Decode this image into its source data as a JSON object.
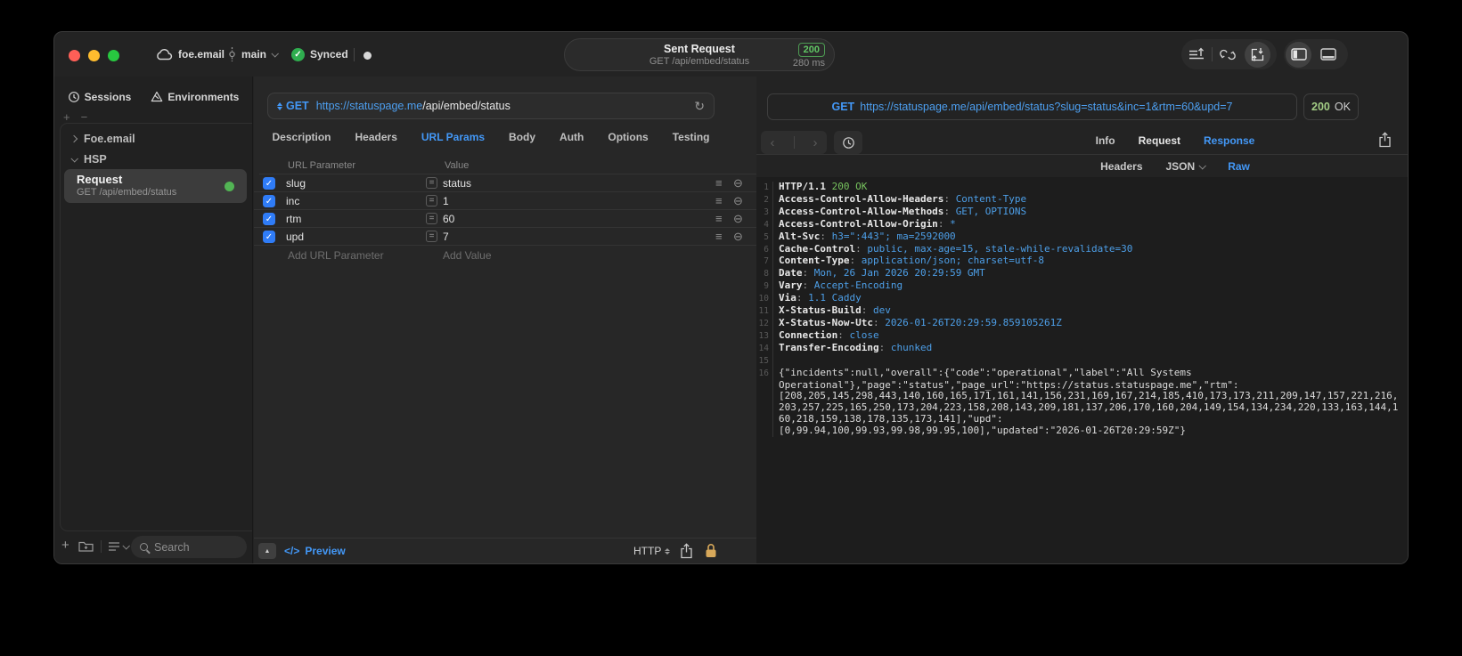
{
  "titlebar": {
    "project": "foe.email",
    "branch": "main",
    "sync": "Synced",
    "request_title": "Sent Request",
    "request_subtitle": "GET /api/embed/status",
    "status_code": "200",
    "duration": "280 ms"
  },
  "sidebar": {
    "tabs": [
      {
        "label": "Sessions"
      },
      {
        "label": "Environments"
      }
    ],
    "tree": [
      {
        "label": "Foe.email"
      },
      {
        "label": "HSP"
      }
    ],
    "request_item": {
      "title": "Request",
      "subtitle": "GET /api/embed/status"
    },
    "search_placeholder": "Search"
  },
  "request": {
    "method": "GET",
    "url_host": "https://statuspage.me",
    "url_path": "/api/embed/status",
    "tabs": [
      {
        "label": "Description"
      },
      {
        "label": "Headers"
      },
      {
        "label": "URL Params"
      },
      {
        "label": "Body"
      },
      {
        "label": "Auth"
      },
      {
        "label": "Options"
      },
      {
        "label": "Testing"
      }
    ],
    "active_tab": "URL Params",
    "table": {
      "col_param": "URL Parameter",
      "col_value": "Value",
      "rows": [
        {
          "name": "slug",
          "value": "status"
        },
        {
          "name": "inc",
          "value": "1"
        },
        {
          "name": "rtm",
          "value": "60"
        },
        {
          "name": "upd",
          "value": "7"
        }
      ],
      "add_param": "Add URL Parameter",
      "add_value": "Add Value"
    },
    "footer": {
      "preview": "Preview",
      "protocol": "HTTP"
    }
  },
  "response": {
    "method": "GET",
    "url": "https://statuspage.me/api/embed/status?slug=status&inc=1&rtm=60&upd=7",
    "status_code": "200",
    "status_text": "OK",
    "tabs": [
      {
        "label": "Info"
      },
      {
        "label": "Request"
      },
      {
        "label": "Response"
      }
    ],
    "active_tab": "Response",
    "subtabs": [
      {
        "label": "Headers"
      },
      {
        "label": "JSON"
      },
      {
        "label": "Raw"
      }
    ],
    "active_subtab": "Raw",
    "lines": [
      {
        "n": "1",
        "seg": [
          [
            "HTTP/1.1 ",
            "h"
          ],
          [
            "200 OK",
            "g"
          ]
        ]
      },
      {
        "n": "2",
        "seg": [
          [
            "Access-Control-Allow-Headers",
            "h"
          ],
          [
            ": ",
            "p"
          ],
          [
            "Content-Type",
            "v"
          ]
        ]
      },
      {
        "n": "3",
        "seg": [
          [
            "Access-Control-Allow-Methods",
            "h"
          ],
          [
            ": ",
            "p"
          ],
          [
            "GET, OPTIONS",
            "v"
          ]
        ]
      },
      {
        "n": "4",
        "seg": [
          [
            "Access-Control-Allow-Origin",
            "h"
          ],
          [
            ": ",
            "p"
          ],
          [
            "*",
            "v"
          ]
        ]
      },
      {
        "n": "5",
        "seg": [
          [
            "Alt-Svc",
            "h"
          ],
          [
            ": ",
            "p"
          ],
          [
            "h3=\":443\"; ma=2592000",
            "v"
          ]
        ]
      },
      {
        "n": "6",
        "seg": [
          [
            "Cache-Control",
            "h"
          ],
          [
            ": ",
            "p"
          ],
          [
            "public, max-age=15, stale-while-revalidate=30",
            "v"
          ]
        ]
      },
      {
        "n": "7",
        "seg": [
          [
            "Content-Type",
            "h"
          ],
          [
            ": ",
            "p"
          ],
          [
            "application/json; charset=utf-8",
            "v"
          ]
        ]
      },
      {
        "n": "8",
        "seg": [
          [
            "Date",
            "h"
          ],
          [
            ": ",
            "p"
          ],
          [
            "Mon, 26 Jan 2026 20:29:59 GMT",
            "v"
          ]
        ]
      },
      {
        "n": "9",
        "seg": [
          [
            "Vary",
            "h"
          ],
          [
            ": ",
            "p"
          ],
          [
            "Accept-Encoding",
            "v"
          ]
        ]
      },
      {
        "n": "10",
        "seg": [
          [
            "Via",
            "h"
          ],
          [
            ": ",
            "p"
          ],
          [
            "1.1 Caddy",
            "v"
          ]
        ]
      },
      {
        "n": "11",
        "seg": [
          [
            "X-Status-Build",
            "h"
          ],
          [
            ": ",
            "p"
          ],
          [
            "dev",
            "v"
          ]
        ]
      },
      {
        "n": "12",
        "seg": [
          [
            "X-Status-Now-Utc",
            "h"
          ],
          [
            ": ",
            "p"
          ],
          [
            "2026-01-26T20:29:59.859105261Z",
            "v"
          ]
        ]
      },
      {
        "n": "13",
        "seg": [
          [
            "Connection",
            "h"
          ],
          [
            ": ",
            "p"
          ],
          [
            "close",
            "v"
          ]
        ]
      },
      {
        "n": "14",
        "seg": [
          [
            "Transfer-Encoding",
            "h"
          ],
          [
            ": ",
            "p"
          ],
          [
            "chunked",
            "v"
          ]
        ]
      },
      {
        "n": "15",
        "seg": []
      },
      {
        "n": "16",
        "seg": [
          [
            "{\"incidents\":null,\"overall\":{\"code\":\"operational\",\"label\":\"All Systems",
            "b"
          ]
        ]
      },
      {
        "n": "",
        "seg": [
          [
            "Operational\"},\"page\":\"status\",\"page_url\":\"https://status.statuspage.me\",\"rtm\":",
            "b"
          ]
        ]
      },
      {
        "n": "",
        "seg": [
          [
            "[208,205,145,298,443,140,160,165,171,161,141,156,231,169,167,214,185,410,173,173,211,209,147,157,221,216,",
            "b"
          ]
        ]
      },
      {
        "n": "",
        "seg": [
          [
            "203,257,225,165,250,173,204,223,158,208,143,209,181,137,206,170,160,204,149,154,134,234,220,133,163,144,1",
            "b"
          ]
        ]
      },
      {
        "n": "",
        "seg": [
          [
            "60,218,159,138,178,135,173,141],\"upd\":",
            "b"
          ]
        ]
      },
      {
        "n": "",
        "seg": [
          [
            "[0,99.94,100,99.93,99.98,99.95,100],\"updated\":\"2026-01-26T20:29:59Z\"}",
            "b"
          ]
        ]
      }
    ]
  },
  "icons": {
    "check": "✓",
    "equals": "=",
    "hamburger": "≡",
    "circle_minus": "⊖",
    "refresh": "↻",
    "plus": "+",
    "minus": "−",
    "back": "‹",
    "forward": "›",
    "triangle_up": "▲",
    "code": "</>"
  },
  "colors": {
    "accent": "#4398f7",
    "success": "#61c765",
    "status_green": "#a3cd85",
    "lock_amber": "#d7a85a"
  }
}
